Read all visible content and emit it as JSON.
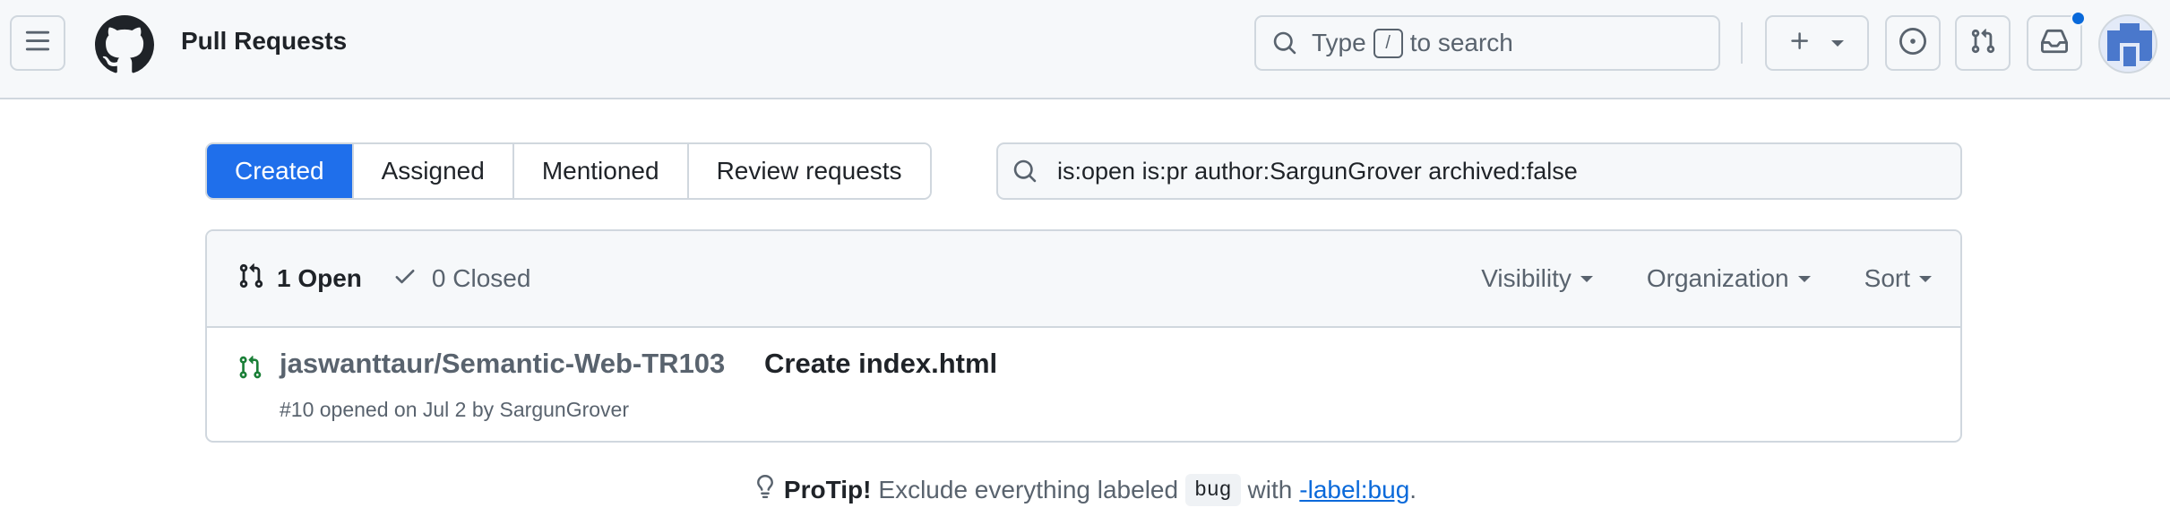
{
  "header": {
    "title": "Pull Requests",
    "search": {
      "prefix": "Type",
      "key": "/",
      "suffix": "to search"
    }
  },
  "tabs": [
    {
      "label": "Created",
      "active": true
    },
    {
      "label": "Assigned",
      "active": false
    },
    {
      "label": "Mentioned",
      "active": false
    },
    {
      "label": "Review requests",
      "active": false
    }
  ],
  "filter": {
    "query": "is:open is:pr author:SargunGrover archived:false"
  },
  "list": {
    "open_label": "1 Open",
    "closed_label": "0 Closed",
    "filters": [
      "Visibility",
      "Organization",
      "Sort"
    ],
    "items": [
      {
        "repo": "jaswanttaur/Semantic-Web-TR103",
        "title": "Create index.html",
        "meta": "#10 opened on Jul 2 by SargunGrover"
      }
    ]
  },
  "protip": {
    "label": "ProTip!",
    "text_before": "Exclude everything labeled",
    "code": "bug",
    "text_mid": "with",
    "link": "-label:bug",
    "text_after": "."
  },
  "colors": {
    "accent": "#1f6feb",
    "open_icon": "#1a7f37",
    "link": "#0969da",
    "notification": "#0969da"
  },
  "icons": [
    "hamburger-icon",
    "github-logo",
    "search-icon",
    "plus-icon",
    "issue-opened-icon",
    "git-pull-request-icon",
    "inbox-icon",
    "check-icon",
    "light-bulb-icon"
  ]
}
